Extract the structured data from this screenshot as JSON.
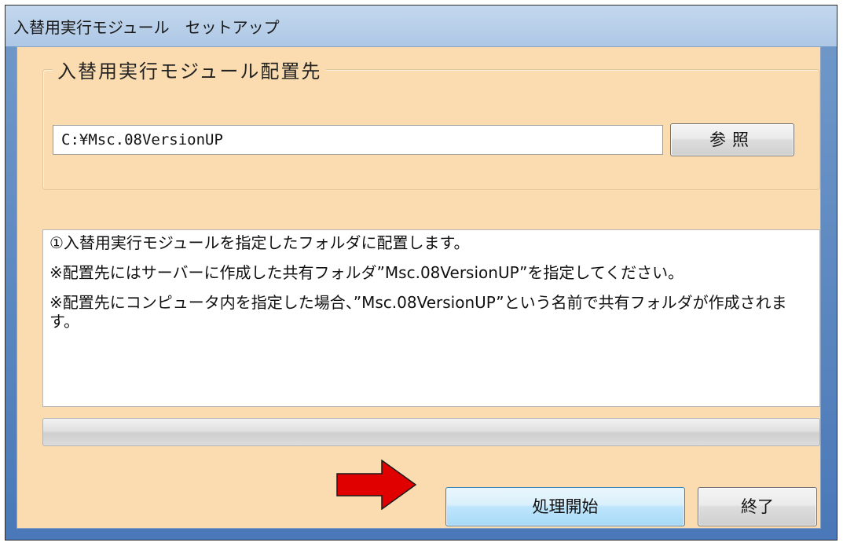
{
  "window": {
    "title": "入替用実行モジュール　セットアップ"
  },
  "placement": {
    "group_label": "入替用実行モジュール配置先",
    "path_value": "C:¥Msc.08VersionUP",
    "browse_label": "参照"
  },
  "messages": [
    "①入替用実行モジュールを指定したフォルダに配置します。",
    "※配置先にはサーバーに作成した共有フォルダ”Msc.08VersionUP”を指定してください。",
    "※配置先にコンピュータ内を指定した場合、”Msc.08VersionUP”という名前で共有フォルダが作成されます。"
  ],
  "progress": {
    "value": 0
  },
  "buttons": {
    "start_label": "処理開始",
    "exit_label": "終了"
  },
  "annotation": {
    "arrow_icon": "red-right-arrow-icon",
    "arrow_color": "#e00000"
  },
  "colors": {
    "client_background": "#fbdcb0",
    "titlebar": "#b8cfe9",
    "start_button_border": "#3c7fb1"
  }
}
